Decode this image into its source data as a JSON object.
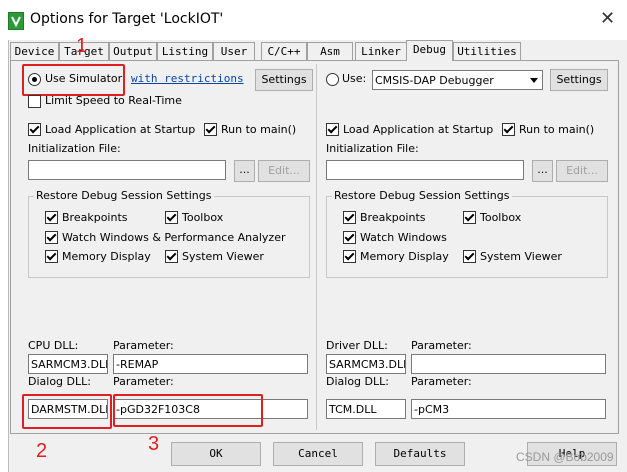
{
  "window": {
    "title": "Options for Target 'LockIOT'",
    "close_glyph": "✕"
  },
  "tabs": [
    {
      "label": "Device"
    },
    {
      "label": "Target"
    },
    {
      "label": "Output"
    },
    {
      "label": "Listing"
    },
    {
      "label": "User"
    },
    {
      "label": "C/C++"
    },
    {
      "label": "Asm"
    },
    {
      "label": "Linker"
    },
    {
      "label": "Debug",
      "active": true
    },
    {
      "label": "Utilities"
    }
  ],
  "left": {
    "use_simulator": "Use Simulator",
    "with_restrictions": "with restrictions",
    "settings": "Settings",
    "limit_speed": "Limit Speed to Real-Time",
    "load_app": "Load Application at Startup",
    "run_to_main": "Run to main()",
    "init_file_label": "Initialization File:",
    "init_file_value": "",
    "browse": "...",
    "edit": "Edit...",
    "restore_group": "Restore Debug Session Settings",
    "breakpoints": "Breakpoints",
    "toolbox": "Toolbox",
    "watch": "Watch Windows & Performance Analyzer",
    "memory": "Memory Display",
    "system_viewer": "System Viewer",
    "cpu_dll_label": "CPU DLL:",
    "cpu_param_label": "Parameter:",
    "cpu_dll": "SARMCM3.DLL",
    "cpu_param": "-REMAP",
    "dialog_dll_label": "Dialog DLL:",
    "dialog_param_label": "Parameter:",
    "dialog_dll": "DARMSTM.DLL",
    "dialog_param": "-pGD32F103C8"
  },
  "right": {
    "use": "Use:",
    "debugger": "CMSIS-DAP Debugger",
    "settings": "Settings",
    "load_app": "Load Application at Startup",
    "run_to_main": "Run to main()",
    "init_file_label": "Initialization File:",
    "init_file_value": "",
    "browse": "...",
    "edit": "Edit...",
    "restore_group": "Restore Debug Session Settings",
    "breakpoints": "Breakpoints",
    "toolbox": "Toolbox",
    "watch": "Watch Windows",
    "memory": "Memory Display",
    "system_viewer": "System Viewer",
    "driver_dll_label": "Driver DLL:",
    "driver_param_label": "Parameter:",
    "driver_dll": "SARMCM3.DLL",
    "driver_param": "",
    "dialog_dll_label": "Dialog DLL:",
    "dialog_param_label": "Parameter:",
    "dialog_dll": "TCM.DLL",
    "dialog_param": "-pCM3"
  },
  "buttons": {
    "ok": "OK",
    "cancel": "Cancel",
    "defaults": "Defaults",
    "help": "Help"
  },
  "annotations": {
    "n1": "1",
    "n2": "2",
    "n3": "3"
  },
  "watermark": "CSDN @Bob2009",
  "colors": {
    "annotation_red": "#e02020",
    "app_icon_green": "#2d9a3a"
  }
}
